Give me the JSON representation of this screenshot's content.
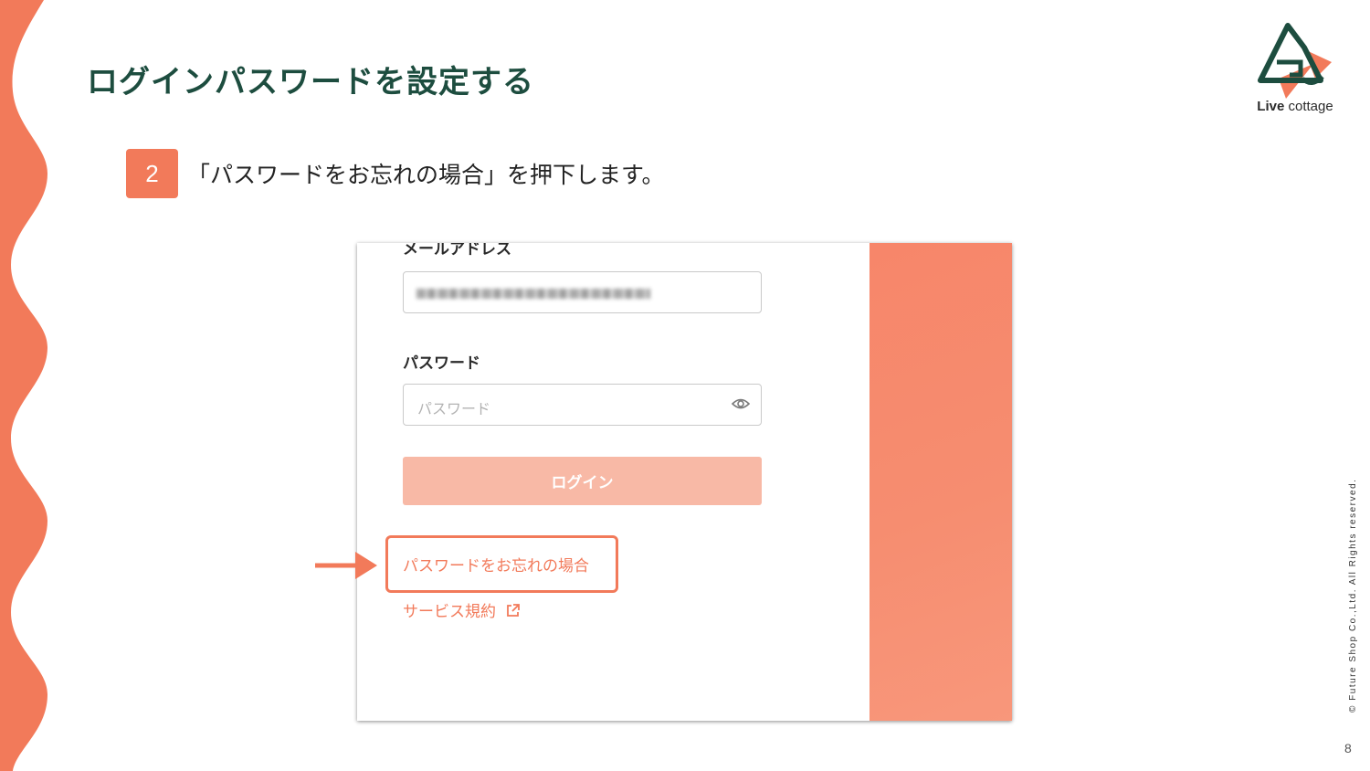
{
  "colors": {
    "accent": "#f27a5a",
    "title_green": "#1d4d3f",
    "panel": "#f7866a",
    "button_disabled": "#f8b9a6"
  },
  "slide": {
    "title": "ログインパスワードを設定する",
    "step_number": "2",
    "step_text": "「パスワードをお忘れの場合」を押下します。",
    "page_number": "8",
    "copyright": "© Future Shop Co.,Ltd. All Rights reserved."
  },
  "logo": {
    "brand_bold": "Live",
    "brand_rest": " cottage",
    "icon": "house-mountain-logo-icon"
  },
  "screenshot": {
    "email_label": "メールアドレス",
    "password_label": "パスワード",
    "password_placeholder": "パスワード",
    "login_button": "ログイン",
    "forgot_link": "パスワードをお忘れの場合",
    "terms_link": "サービス規約",
    "icons": [
      "eye-icon",
      "external-link-icon"
    ]
  },
  "annotation": {
    "icon": "arrow-right-icon"
  }
}
